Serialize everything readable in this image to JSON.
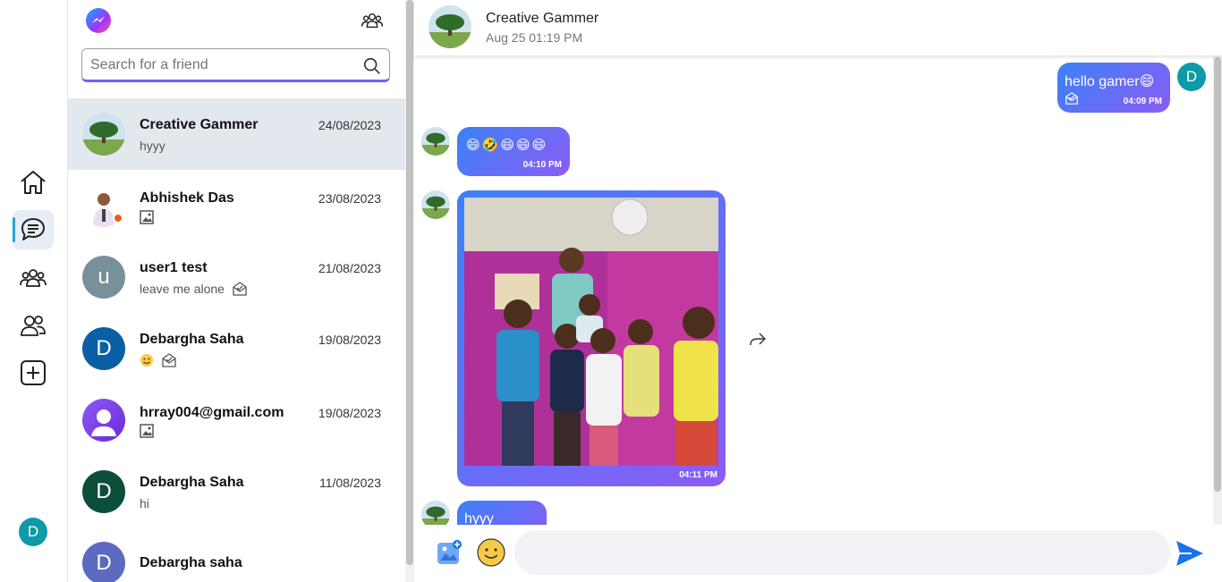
{
  "sidebar_nav": {
    "items": [
      {
        "name": "home-icon"
      },
      {
        "name": "chats-icon",
        "active": true
      },
      {
        "name": "groups-icon"
      },
      {
        "name": "friends-icon"
      },
      {
        "name": "add-icon"
      }
    ],
    "user_initial": "D"
  },
  "conversation_list": {
    "search": {
      "placeholder": "Search for a friend",
      "value": ""
    },
    "conversations": [
      {
        "name": "Creative Gammer",
        "date": "24/08/2023",
        "preview": "hyyy",
        "active": true
      },
      {
        "name": "Abhishek Das",
        "date": "23/08/2023",
        "preview_icon": "image-icon",
        "online": true
      },
      {
        "name": "user1 test",
        "date": "21/08/2023",
        "preview": "leave me alone",
        "avatar_letter": "u",
        "read_icon": "read-envelope-icon"
      },
      {
        "name": "Debargha Saha",
        "date": "19/08/2023",
        "preview_icon": "emoji-icon",
        "avatar_letter": "D",
        "read_icon": "read-envelope-icon"
      },
      {
        "name": "hrray004@gmail.com",
        "date": "19/08/2023",
        "preview_icon": "image-icon"
      },
      {
        "name": "Debargha Saha",
        "date": "11/08/2023",
        "preview": "hi",
        "avatar_letter": "D"
      },
      {
        "name": "Debargha saha",
        "date": "",
        "avatar_letter": "D"
      }
    ]
  },
  "chat": {
    "header": {
      "name": "Creative Gammer",
      "last_seen": "Aug 25 01:19 PM"
    },
    "messages": [
      {
        "sender": "me",
        "text": "hello gamer😄",
        "time": "04:09 PM"
      },
      {
        "sender": "them",
        "text": "😄🤣😄😄😄",
        "time": "04:10 PM"
      },
      {
        "sender": "them",
        "type": "image",
        "time": "04:11 PM"
      },
      {
        "sender": "them",
        "text": "hyyy"
      }
    ],
    "composer": {
      "value": "",
      "placeholder": ""
    },
    "me_initial": "D"
  },
  "colors": {
    "accent": "#6c63ff",
    "bubble_start": "#3b82f6",
    "bubble_end": "#8b5cf6",
    "active_row": "#e3e8ee",
    "send": "#1a73e8"
  }
}
